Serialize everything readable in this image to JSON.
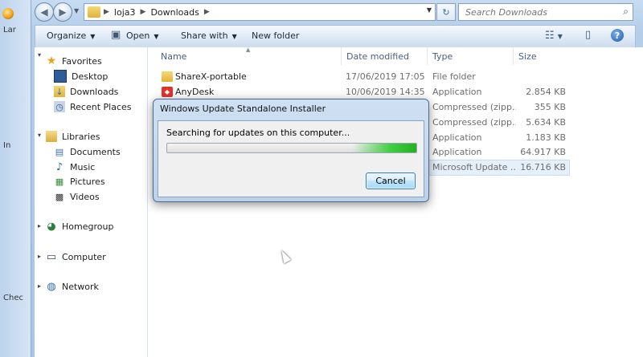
{
  "address": {
    "crumbs": [
      "loja3",
      "Downloads"
    ]
  },
  "search": {
    "placeholder": "Search Downloads"
  },
  "toolbar": {
    "organize": "Organize",
    "open": "Open",
    "share_with": "Share with",
    "new_folder": "New folder"
  },
  "nav": {
    "favorites": "Favorites",
    "desktop": "Desktop",
    "downloads": "Downloads",
    "recent_places": "Recent Places",
    "libraries": "Libraries",
    "documents": "Documents",
    "music": "Music",
    "pictures": "Pictures",
    "videos": "Videos",
    "homegroup": "Homegroup",
    "computer": "Computer",
    "network": "Network"
  },
  "columns": {
    "name": "Name",
    "date": "Date modified",
    "type": "Type",
    "size": "Size"
  },
  "files": [
    {
      "name": "ShareX-portable",
      "date": "17/06/2019 17:05",
      "type": "File folder",
      "size": ""
    },
    {
      "name": "AnyDesk",
      "date": "10/06/2019 14:35",
      "type": "Application",
      "size": "2.854 KB"
    },
    {
      "name": "",
      "date": "",
      "type": "Compressed (zipp...",
      "size": "355 KB"
    },
    {
      "name": "",
      "date": "",
      "type": "Compressed (zipp...",
      "size": "5.634 KB"
    },
    {
      "name": "",
      "date": "",
      "type": "Application",
      "size": "1.183 KB"
    },
    {
      "name": "",
      "date": "",
      "type": "Application",
      "size": "64.917 KB"
    },
    {
      "name": "",
      "date": "",
      "type": "Microsoft Update ...",
      "size": "16.716 KB"
    }
  ],
  "left_strip": {
    "top_stub": "Lar",
    "mid_stub": "In",
    "bottom_stub": "Chec"
  },
  "dialog": {
    "title": "Windows Update Standalone Installer",
    "message": "Searching for updates on this computer...",
    "cancel": "Cancel"
  }
}
